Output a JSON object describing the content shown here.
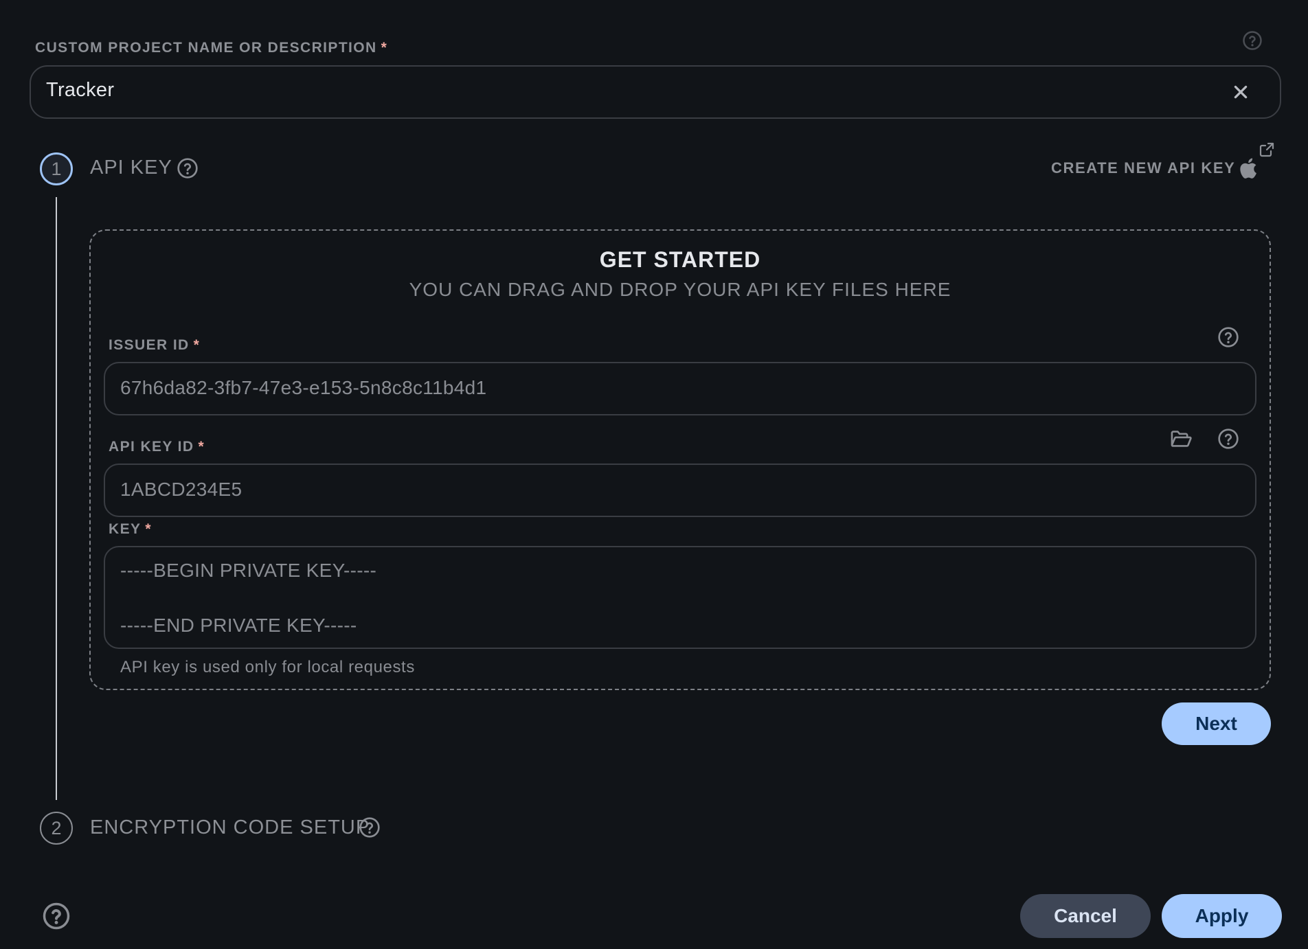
{
  "project": {
    "label": "CUSTOM PROJECT NAME OR DESCRIPTION",
    "required_mark": "*",
    "value": "Tracker"
  },
  "steps": [
    {
      "number": "1",
      "title": "API KEY",
      "state": "active",
      "create_link_label": "CREATE NEW API KEY",
      "dropzone": {
        "title": "GET STARTED",
        "subtitle": "YOU CAN DRAG AND DROP YOUR API KEY FILES HERE"
      },
      "fields": {
        "issuer_id": {
          "label": "ISSUER ID",
          "required_mark": "*",
          "placeholder": "67h6da82-3fb7-47e3-e153-5n8c8c11b4d1"
        },
        "api_key_id": {
          "label": "API KEY ID",
          "required_mark": "*",
          "placeholder": "1ABCD234E5"
        },
        "key": {
          "label": "KEY",
          "required_mark": "*",
          "placeholder_line1": "-----BEGIN PRIVATE KEY-----",
          "placeholder_line2": "-----END PRIVATE KEY-----"
        }
      },
      "helper_text": "API key is used only for local requests",
      "next_label": "Next"
    },
    {
      "number": "2",
      "title": "ENCRYPTION CODE SETUP",
      "state": "inactive"
    }
  ],
  "footer": {
    "cancel_label": "Cancel",
    "apply_label": "Apply"
  },
  "icons": {
    "help": "question-circle",
    "clear": "x-mark",
    "apple": "apple-logo",
    "external": "external-link",
    "folder": "folder-open"
  },
  "colors": {
    "background": "#111418",
    "primary": "#a6cbff",
    "primary_text": "#0b2f57",
    "secondary_button": "#3e4656",
    "required": "#f0a8a0",
    "active_step_border": "#9ec3f5"
  }
}
